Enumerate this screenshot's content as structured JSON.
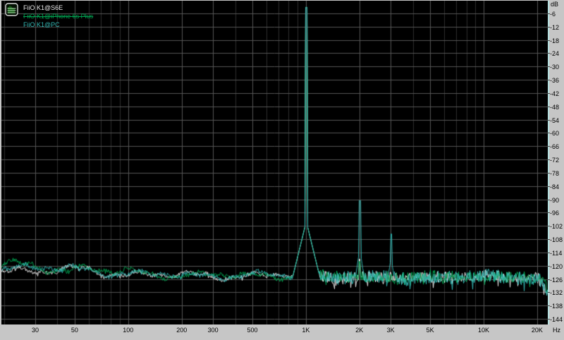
{
  "window": {
    "name": "RMAA noise spectrum plot"
  },
  "legend": {
    "items": [
      {
        "label": "FiiO K1@S6E",
        "color": "#e9e9e9",
        "strikethrough": false
      },
      {
        "label": "FiiO K1@iPhone 6s Plus",
        "color": "#00a552",
        "strikethrough": true
      },
      {
        "label": "FiiO K1@PC",
        "color": "#33b7b3",
        "strikethrough": false
      }
    ]
  },
  "axes": {
    "y": {
      "unit": "dB",
      "tick_step_db": 6,
      "tick_labels": [
        "-6",
        "-12",
        "-18",
        "-24",
        "-30",
        "-36",
        "-42",
        "-48",
        "-54",
        "-60",
        "-66",
        "-72",
        "-78",
        "-84",
        "-90",
        "-96",
        "-102",
        "-108",
        "-114",
        "-120",
        "-126",
        "-132",
        "-138",
        "-144"
      ]
    },
    "x": {
      "unit": "Hz",
      "scale": "log",
      "labeled_ticks": [
        {
          "f": 30,
          "label": "30"
        },
        {
          "f": 50,
          "label": "50"
        },
        {
          "f": 100,
          "label": "100"
        },
        {
          "f": 200,
          "label": "200"
        },
        {
          "f": 300,
          "label": "300"
        },
        {
          "f": 500,
          "label": "500"
        },
        {
          "f": 1000,
          "label": "1K"
        },
        {
          "f": 2000,
          "label": "2K"
        },
        {
          "f": 3000,
          "label": "3K"
        },
        {
          "f": 5000,
          "label": "5K"
        },
        {
          "f": 10000,
          "label": "10K"
        },
        {
          "f": 20000,
          "label": "20K"
        }
      ],
      "minor_ticks": [
        20,
        40,
        60,
        70,
        80,
        90,
        400,
        600,
        700,
        800,
        900,
        4000,
        6000,
        7000,
        8000,
        9000
      ]
    }
  },
  "colors": {
    "background": "#000000",
    "margin": "#c6c6c6",
    "grid_major": "#565656",
    "grid_minor": "#2d2d2d",
    "plot_right_border": "#b5dede",
    "label_text": "#000000"
  },
  "chart_data": {
    "type": "line",
    "title": "",
    "xlabel": "Hz",
    "ylabel": "dB",
    "x_scale": "log",
    "x_range_hz": [
      19.3,
      23000
    ],
    "y_range_db": [
      -147,
      0
    ],
    "grid": true,
    "legend_position": "top-left",
    "summary": {
      "main_tone": {
        "freq_hz": 1000,
        "level_db": -3.3,
        "all_series": true
      },
      "noise_floor_db": -125,
      "harmonic_peaks": [
        {
          "series": "FiiO K1@PC",
          "freq_hz": 2000,
          "level_db": -91
        },
        {
          "series": "FiiO K1@PC",
          "freq_hz": 3000,
          "level_db": -106
        }
      ],
      "right_edge_rolloff": {
        "from_hz": 21000,
        "to_hz": 23000,
        "drop_to_db": -131
      }
    },
    "series": [
      {
        "name": "FiiO K1@S6E",
        "color": "#e9e9e9",
        "seed": 11,
        "noise_control_points": [
          [
            19,
            -121.6
          ],
          [
            35,
            -122.0
          ],
          [
            60,
            -122.5
          ],
          [
            100,
            -123.5
          ],
          [
            200,
            -124.3
          ],
          [
            400,
            -124.5
          ],
          [
            700,
            -124.2
          ],
          [
            1200,
            -124.8
          ],
          [
            2500,
            -125.2
          ],
          [
            6000,
            -125.2
          ],
          [
            12000,
            -124.9
          ],
          [
            20000,
            -125.2
          ],
          [
            21500,
            -128.5
          ],
          [
            23000,
            -131.5
          ]
        ],
        "smooth_amp_db": [
          2.4,
          1.8,
          0.6
        ],
        "spike_amp_db": [
          0.9,
          2.6
        ],
        "peaks": [
          {
            "f": 1000,
            "tip": -3.4,
            "core": 1.6,
            "skirt_base": -100,
            "skirt_slope": 1.3
          },
          {
            "f": 2000,
            "tip": -117,
            "core": 1.0,
            "skirt_base": -121,
            "skirt_slope": 3.0
          }
        ]
      },
      {
        "name": "FiiO K1@iPhone 6s Plus",
        "color": "#00a552",
        "seed": 22,
        "noise_control_points": [
          [
            19,
            -119.8
          ],
          [
            35,
            -120.6
          ],
          [
            60,
            -121.4
          ],
          [
            100,
            -123.2
          ],
          [
            200,
            -124.2
          ],
          [
            400,
            -124.4
          ],
          [
            700,
            -124.1
          ],
          [
            1200,
            -124.7
          ],
          [
            2500,
            -125.1
          ],
          [
            6000,
            -125.1
          ],
          [
            12000,
            -124.8
          ],
          [
            20000,
            -125.1
          ],
          [
            21500,
            -128.3
          ],
          [
            23000,
            -131.3
          ]
        ],
        "smooth_amp_db": [
          2.6,
          1.9,
          0.7
        ],
        "spike_amp_db": [
          0.9,
          2.7
        ],
        "peaks": [
          {
            "f": 1000,
            "tip": -3.4,
            "core": 1.6,
            "skirt_base": -100,
            "skirt_slope": 1.3
          },
          {
            "f": 2000,
            "tip": -118,
            "core": 1.0,
            "skirt_base": -121,
            "skirt_slope": 3.0
          }
        ]
      },
      {
        "name": "FiiO K1@PC",
        "color": "#33b7b3",
        "seed": 33,
        "noise_control_points": [
          [
            19,
            -120.6
          ],
          [
            35,
            -121.2
          ],
          [
            60,
            -122.0
          ],
          [
            100,
            -123.4
          ],
          [
            200,
            -124.3
          ],
          [
            400,
            -124.5
          ],
          [
            700,
            -124.2
          ],
          [
            1200,
            -124.9
          ],
          [
            2500,
            -125.3
          ],
          [
            6000,
            -125.3
          ],
          [
            12000,
            -125.0
          ],
          [
            20000,
            -125.4
          ],
          [
            21500,
            -128.6
          ],
          [
            23000,
            -131.6
          ]
        ],
        "smooth_amp_db": [
          2.3,
          1.7,
          0.7
        ],
        "spike_amp_db": [
          1.0,
          3.0
        ],
        "peaks": [
          {
            "f": 1000,
            "tip": -3.3,
            "core": 1.6,
            "skirt_base": -100,
            "skirt_slope": 1.3
          },
          {
            "f": 2000,
            "tip": -90.6,
            "core": 1.2,
            "skirt_base": -112,
            "skirt_slope": 2.2
          },
          {
            "f": 3000,
            "tip": -105.6,
            "core": 1.0,
            "skirt_base": -116,
            "skirt_slope": 2.2
          }
        ]
      }
    ]
  }
}
